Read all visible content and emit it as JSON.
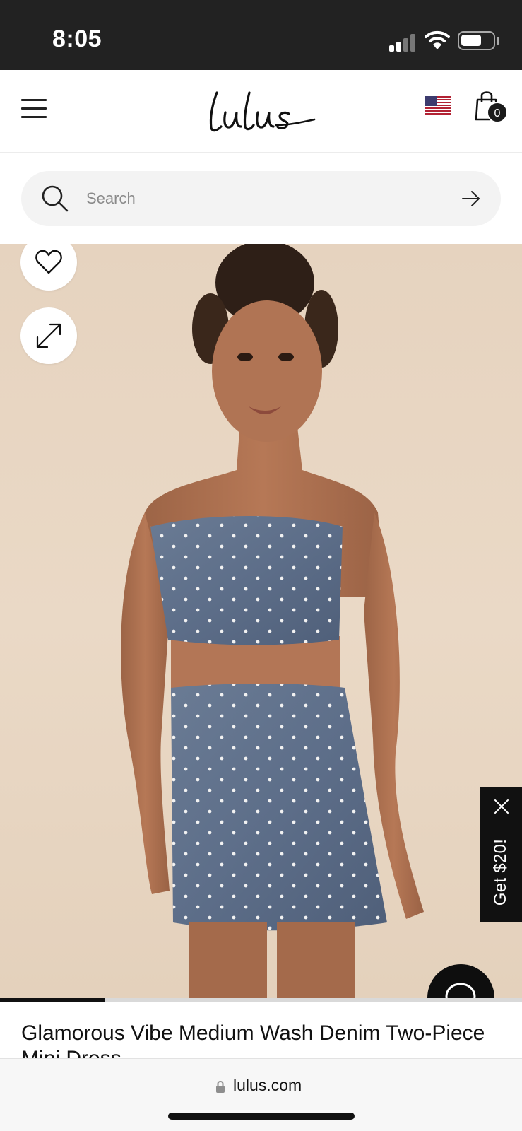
{
  "status_bar": {
    "time": "8:05",
    "icons": [
      "cellular-signal-icon",
      "wifi-icon",
      "battery-icon"
    ]
  },
  "header": {
    "logo_text": "Lulus",
    "cart_count": "0",
    "icons": [
      "menu-icon",
      "us-flag-icon",
      "shopping-bag-icon"
    ]
  },
  "search": {
    "placeholder": "Search",
    "value": ""
  },
  "product": {
    "image_alt": "Glamorous Vibe Medium Wash Denim Two-Piece Mini Dress",
    "title": "Glamorous Vibe Medium Wash Denim Two-Piece Mini Dress",
    "image_progress_fraction": 0.2
  },
  "promo": {
    "label": "Get $20!"
  },
  "browser": {
    "url": "lulus.com"
  },
  "colors": {
    "header_bg": "#222222",
    "accent_dark": "#111111",
    "search_bg": "#f3f3f3",
    "denim": "#5c6e88"
  }
}
